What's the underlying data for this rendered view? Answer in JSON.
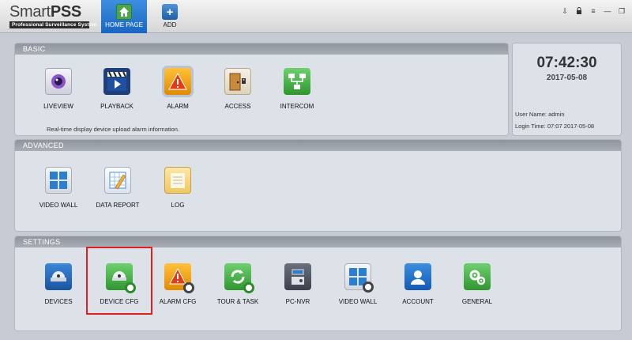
{
  "app": {
    "title": "SmartPSS",
    "title_light": "Smart",
    "title_bold": "PSS",
    "subtitle": "Professional Surveillance System"
  },
  "tabs": [
    {
      "label": "HOME PAGE",
      "icon": "home-icon"
    },
    {
      "label": "ADD",
      "icon": "plus-icon",
      "glyph": "+"
    }
  ],
  "window_controls": [
    {
      "name": "user-icon",
      "glyph": "⇩"
    },
    {
      "name": "lock-icon",
      "glyph": "🔒"
    },
    {
      "name": "menu-icon",
      "glyph": "≡"
    },
    {
      "name": "minimize-icon",
      "glyph": "—"
    },
    {
      "name": "restore-icon",
      "glyph": "❐"
    }
  ],
  "basic": {
    "header": "BASIC",
    "description": "Real-time display device upload alarm information.",
    "items": [
      {
        "label": "LIVEVIEW",
        "icon": "camera-icon",
        "color": "#d7d7e6"
      },
      {
        "label": "PLAYBACK",
        "icon": "clapperboard-icon",
        "color": "#1f3f7a"
      },
      {
        "label": "ALARM",
        "icon": "alarm-icon",
        "color": "#f0a800"
      },
      {
        "label": "ACCESS",
        "icon": "door-icon",
        "color": "#b07030"
      },
      {
        "label": "INTERCOM",
        "icon": "network-icon",
        "color": "#49b449"
      }
    ]
  },
  "clock": {
    "time": "07:42:30",
    "date": "2017-05-08",
    "user_name": "User Name: admin",
    "login_time": "Login Time: 07:07 2017-05-08"
  },
  "advanced": {
    "header": "ADVANCED",
    "items": [
      {
        "label": "VIDEO WALL",
        "icon": "grid-icon",
        "color": "#2a7fd0"
      },
      {
        "label": "DATA REPORT",
        "icon": "report-icon",
        "color": "#4a8ad8"
      },
      {
        "label": "LOG",
        "icon": "notepad-icon",
        "color": "#f5d070"
      }
    ]
  },
  "settings": {
    "header": "SETTINGS",
    "items": [
      {
        "label": "DEVICES",
        "icon": "dome-camera-icon",
        "color": "#1f5fa8"
      },
      {
        "label": "DEVICE CFG",
        "icon": "device-config-icon",
        "color": "#49b449"
      },
      {
        "label": "ALARM CFG",
        "icon": "alarm-config-icon",
        "color": "#f0a800"
      },
      {
        "label": "TOUR & TASK",
        "icon": "tour-task-icon",
        "color": "#49b449"
      },
      {
        "label": "PC-NVR",
        "icon": "pc-nvr-icon",
        "color": "#555a66"
      },
      {
        "label": "VIDEO WALL",
        "icon": "video-wall-config-icon",
        "color": "#2a7fd0"
      },
      {
        "label": "ACCOUNT",
        "icon": "account-icon",
        "color": "#1f6fd0"
      },
      {
        "label": "GENERAL",
        "icon": "general-gear-icon",
        "color": "#49b449"
      }
    ]
  }
}
